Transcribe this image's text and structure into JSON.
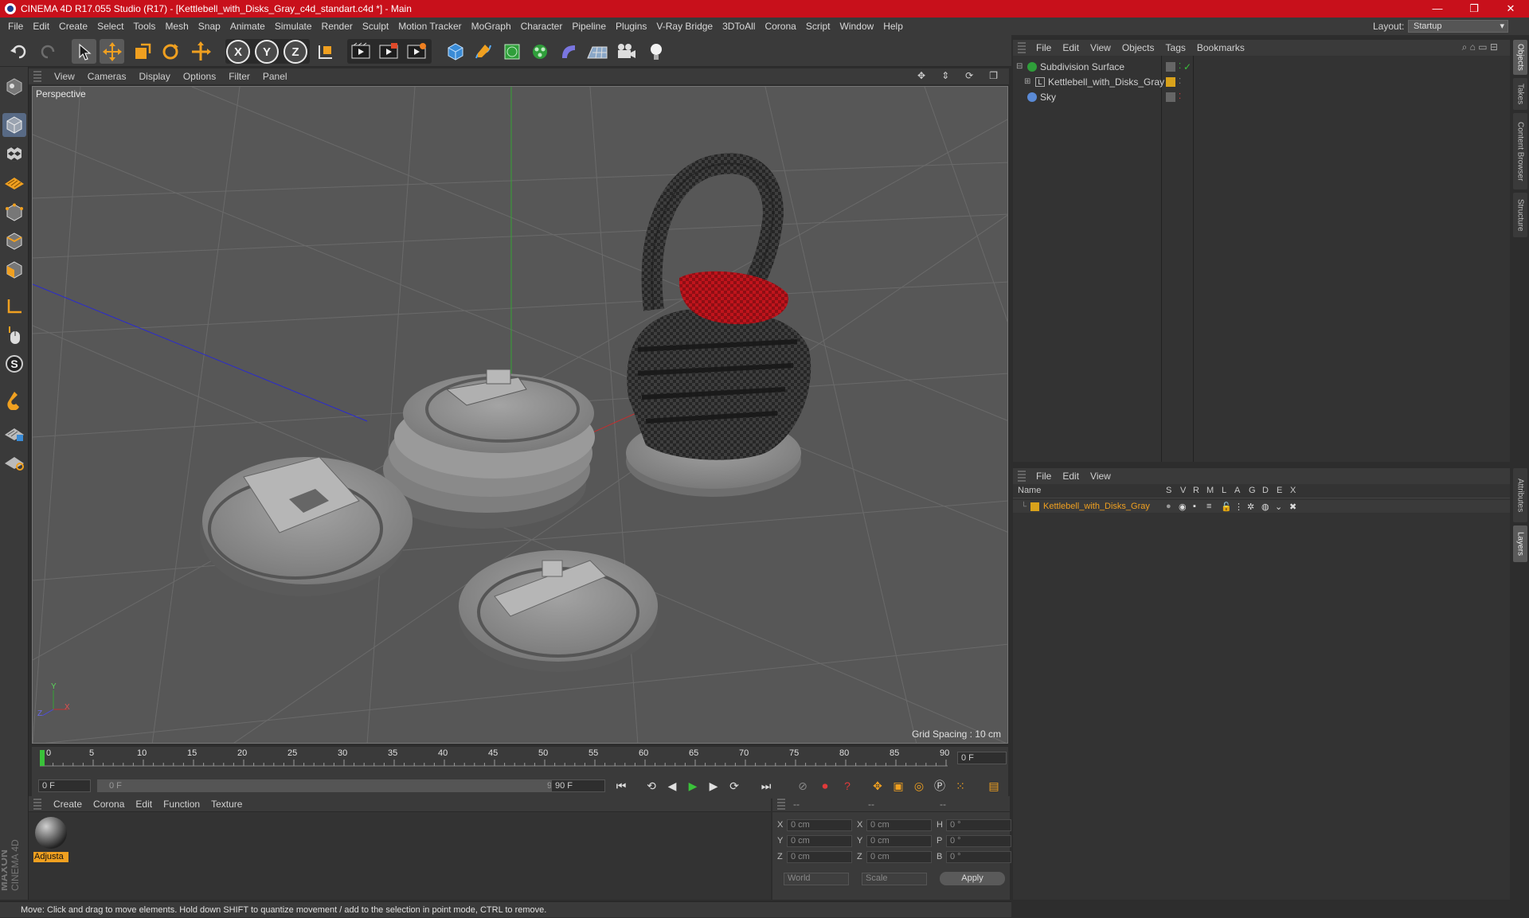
{
  "window": {
    "title": "CINEMA 4D R17.055 Studio (R17) - [Kettlebell_with_Disks_Gray_c4d_standart.c4d *] - Main",
    "controls": [
      "—",
      "❐",
      "✕"
    ]
  },
  "menubar": [
    "File",
    "Edit",
    "Create",
    "Select",
    "Tools",
    "Mesh",
    "Snap",
    "Animate",
    "Simulate",
    "Render",
    "Sculpt",
    "Motion Tracker",
    "MoGraph",
    "Character",
    "Pipeline",
    "Plugins",
    "V-Ray Bridge",
    "3DToAll",
    "Corona",
    "Script",
    "Window",
    "Help"
  ],
  "layout": {
    "label": "Layout:",
    "value": "Startup"
  },
  "toolbar": {
    "axes": [
      "X",
      "Y",
      "Z"
    ]
  },
  "viewport": {
    "menu": [
      "View",
      "Cameras",
      "Display",
      "Options",
      "Filter",
      "Panel"
    ],
    "label": "Perspective",
    "grid_spacing": "Grid Spacing : 10 cm",
    "axis_labels": {
      "y": "Y",
      "x": "X",
      "z": "Z"
    }
  },
  "timeline": {
    "ticks": [
      "0",
      "5",
      "10",
      "15",
      "20",
      "25",
      "30",
      "35",
      "40",
      "45",
      "50",
      "55",
      "60",
      "65",
      "70",
      "75",
      "80",
      "85",
      "90"
    ],
    "current_frame": "0 F",
    "start_field": "0 F",
    "slider_start": "0 F",
    "slider_end": "90 F",
    "end_field": "90 F"
  },
  "material_panel": {
    "menu": [
      "Create",
      "Corona",
      "Edit",
      "Function",
      "Texture"
    ],
    "materials": [
      {
        "name": "Adjusta"
      }
    ]
  },
  "coord_panel": {
    "header": [
      "--",
      "--",
      "--"
    ],
    "rows": [
      {
        "a": "X",
        "av": "0 cm",
        "b": "X",
        "bv": "0 cm",
        "c": "H",
        "cv": "0 °"
      },
      {
        "a": "Y",
        "av": "0 cm",
        "b": "Y",
        "bv": "0 cm",
        "c": "P",
        "cv": "0 °"
      },
      {
        "a": "Z",
        "av": "0 cm",
        "b": "Z",
        "bv": "0 cm",
        "c": "B",
        "cv": "0 °"
      }
    ],
    "mode1": "World",
    "mode2": "Scale",
    "apply": "Apply"
  },
  "status": "Move: Click and drag to move elements. Hold down SHIFT to quantize movement / add to the selection in point mode, CTRL to remove.",
  "object_manager": {
    "menu": [
      "File",
      "Edit",
      "View",
      "Objects",
      "Tags",
      "Bookmarks"
    ],
    "objects": [
      {
        "name": "Subdivision Surface"
      },
      {
        "name": "Kettlebell_with_Disks_Gray"
      },
      {
        "name": "Sky"
      }
    ]
  },
  "layer_manager": {
    "menu": [
      "File",
      "Edit",
      "View"
    ],
    "columns": [
      "Name",
      "S",
      "V",
      "R",
      "M",
      "L",
      "A",
      "G",
      "D",
      "E",
      "X"
    ],
    "layers": [
      {
        "name": "Kettlebell_with_Disks_Gray",
        "color": "#d9a21b"
      }
    ]
  },
  "side_tabs": [
    "Objects",
    "Takes",
    "Content Browser",
    "Structure",
    "Attributes",
    "Layers"
  ],
  "brand": "MAXON CINEMA 4D",
  "colors": {
    "title": "#c8101b",
    "accent": "#f0a020",
    "active": "#586a85"
  }
}
